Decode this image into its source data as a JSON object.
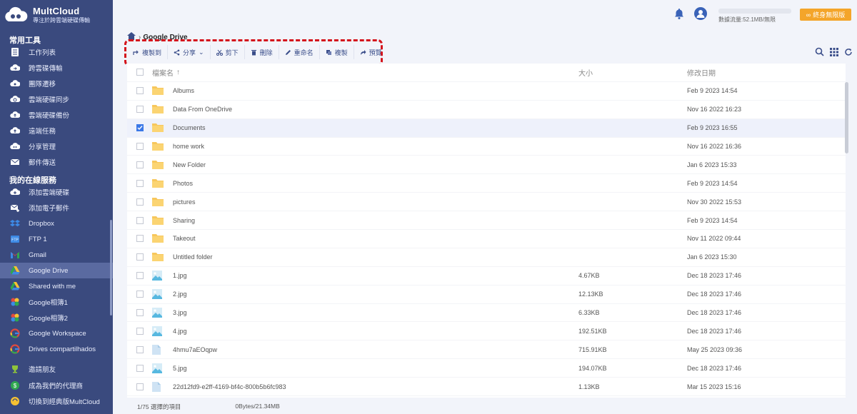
{
  "brand": {
    "name": "MultCloud",
    "tagline": "專注於跨雲端硬碟傳輸"
  },
  "sidebar": {
    "section1": "常用工具",
    "tools": [
      {
        "label": "工作列表",
        "icon": "task-list-icon"
      },
      {
        "label": "跨雲碟傳輸",
        "icon": "cloud-transfer-icon"
      },
      {
        "label": "團隊遷移",
        "icon": "team-migrate-icon"
      },
      {
        "label": "雲端硬碟同步",
        "icon": "cloud-sync-icon"
      },
      {
        "label": "雲端硬碟備份",
        "icon": "cloud-backup-icon"
      },
      {
        "label": "遠端任務",
        "icon": "remote-upload-icon"
      },
      {
        "label": "分享管理",
        "icon": "share-manage-icon"
      },
      {
        "label": "郵件傳送",
        "icon": "email-transfer-icon"
      }
    ],
    "section2": "我的在線服務",
    "services": [
      {
        "label": "添加雲端硬碟",
        "icon": "add-cloud-icon"
      },
      {
        "label": "添加電子郵件",
        "icon": "add-email-icon"
      },
      {
        "label": "Dropbox",
        "icon": "dropbox-icon"
      },
      {
        "label": "FTP 1",
        "icon": "ftp-icon"
      },
      {
        "label": "Gmail",
        "icon": "gmail-icon"
      },
      {
        "label": "Google Drive",
        "icon": "google-drive-icon",
        "active": true
      },
      {
        "label": "Shared with me",
        "icon": "google-drive-icon"
      },
      {
        "label": "Google相簿1",
        "icon": "google-photos-icon"
      },
      {
        "label": "Google相簿2",
        "icon": "google-photos-icon"
      },
      {
        "label": "Google Workspace",
        "icon": "google-icon"
      },
      {
        "label": "Drives compartilhados",
        "icon": "google-icon"
      }
    ],
    "bottom": [
      {
        "label": "邀請朋友",
        "icon": "trophy-icon"
      },
      {
        "label": "成為我們的代理商",
        "icon": "dollar-icon"
      },
      {
        "label": "切換到經典版MultCloud",
        "icon": "switch-icon"
      }
    ]
  },
  "topbar": {
    "traffic": "數據流量:52.1MB/無限",
    "upgrade": "終身無限版"
  },
  "breadcrumb": {
    "current": "Google Drive"
  },
  "toolbar": {
    "copy_to": "複製到",
    "share": "分享",
    "cut": "剪下",
    "delete": "刪除",
    "rename": "重命名",
    "copy": "複製",
    "preview": "預覽"
  },
  "columns": {
    "name": "檔案名",
    "size": "大小",
    "date": "修改日期"
  },
  "files": [
    {
      "name": "Albums",
      "type": "folder",
      "size": "",
      "date": "Feb 9 2023 14:54",
      "checked": false
    },
    {
      "name": "Data From OneDrive",
      "type": "folder",
      "size": "",
      "date": "Nov 16 2022 16:23",
      "checked": false
    },
    {
      "name": "Documents",
      "type": "folder",
      "size": "",
      "date": "Feb 9 2023 16:55",
      "checked": true
    },
    {
      "name": "home work",
      "type": "folder",
      "size": "",
      "date": "Nov 16 2022 16:36",
      "checked": false
    },
    {
      "name": "New Folder",
      "type": "folder",
      "size": "",
      "date": "Jan 6 2023 15:33",
      "checked": false
    },
    {
      "name": "Photos",
      "type": "folder",
      "size": "",
      "date": "Feb 9 2023 14:54",
      "checked": false
    },
    {
      "name": "pictures",
      "type": "folder",
      "size": "",
      "date": "Nov 30 2022 15:53",
      "checked": false
    },
    {
      "name": "Sharing",
      "type": "folder",
      "size": "",
      "date": "Feb 9 2023 14:54",
      "checked": false
    },
    {
      "name": "Takeout",
      "type": "folder",
      "size": "",
      "date": "Nov 11 2022 09:44",
      "checked": false
    },
    {
      "name": "Untitled folder",
      "type": "folder",
      "size": "",
      "date": "Jan 6 2023 15:30",
      "checked": false
    },
    {
      "name": "1.jpg",
      "type": "image",
      "size": "4.67KB",
      "date": "Dec 18 2023 17:46",
      "checked": false
    },
    {
      "name": "2.jpg",
      "type": "image",
      "size": "12.13KB",
      "date": "Dec 18 2023 17:46",
      "checked": false
    },
    {
      "name": "3.jpg",
      "type": "image",
      "size": "6.33KB",
      "date": "Dec 18 2023 17:46",
      "checked": false
    },
    {
      "name": "4.jpg",
      "type": "image",
      "size": "192.51KB",
      "date": "Dec 18 2023 17:46",
      "checked": false
    },
    {
      "name": "4hmu7aEOqpw",
      "type": "file",
      "size": "715.91KB",
      "date": "May 25 2023 09:36",
      "checked": false
    },
    {
      "name": "5.jpg",
      "type": "image",
      "size": "194.07KB",
      "date": "Dec 18 2023 17:46",
      "checked": false
    },
    {
      "name": "22d12fd9-e2ff-4169-bf4c-800b5b6fc983",
      "type": "file",
      "size": "1.13KB",
      "date": "Mar 15 2023 15:16",
      "checked": false
    }
  ],
  "status": {
    "selection": "1/75 選擇的項目",
    "size": "0Bytes/21.34MB"
  },
  "colors": {
    "sidebar": "#3a4a7e",
    "accent": "#3b78e7",
    "folder": "#f7c75c",
    "upgrade": "#f4a52a",
    "highlight": "#d4141c"
  }
}
